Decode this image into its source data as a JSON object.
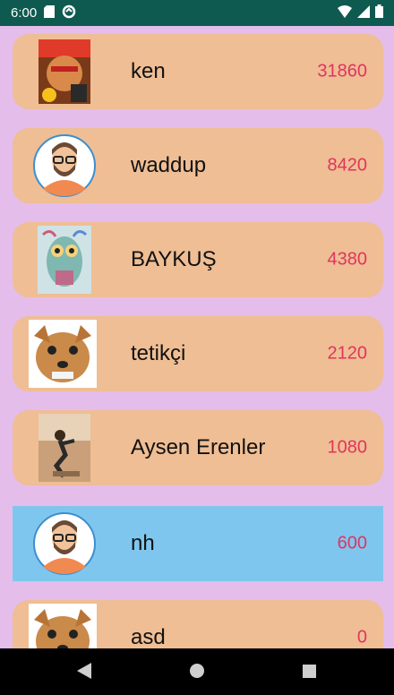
{
  "status": {
    "time": "6:00"
  },
  "players": [
    {
      "name": "ken",
      "score": "31860",
      "avatar": "photo-avatar-ken"
    },
    {
      "name": "waddup",
      "score": "8420",
      "avatar": "default-avatar"
    },
    {
      "name": "BAYKUŞ",
      "score": "4380",
      "avatar": "photo-avatar-owl"
    },
    {
      "name": "tetikçi",
      "score": "2120",
      "avatar": "photo-avatar-dog"
    },
    {
      "name": "Aysen Erenler",
      "score": "1080",
      "avatar": "photo-avatar-person"
    },
    {
      "name": "nh",
      "score": "600",
      "avatar": "default-avatar",
      "highlight": true
    },
    {
      "name": "asd",
      "score": "0",
      "avatar": "photo-avatar-dog"
    }
  ],
  "colors": {
    "background": "#e4bdea",
    "row": "#efbe94",
    "row_highlight": "#7fc6ee",
    "score": "#e0345f",
    "statusbar": "#0f5a50"
  }
}
